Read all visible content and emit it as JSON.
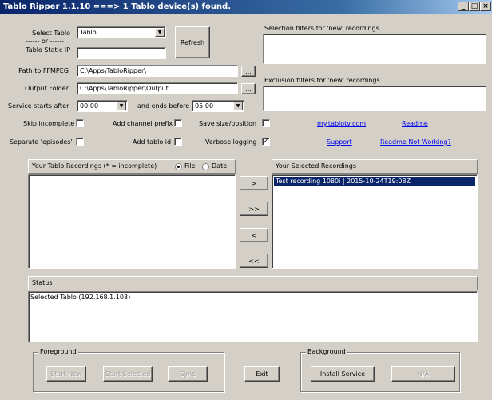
{
  "window": {
    "title": "Tablo Ripper 1.1.10 ===> 1 Tablo device(s) found.",
    "minimize": "_",
    "maximize": "□",
    "close": "×"
  },
  "device": {
    "select_label": "Select Tablo",
    "or_label": "------ or ------",
    "static_ip_label": "Tablo Static IP",
    "selected_tablo": "Tablo",
    "static_ip_value": "",
    "refresh_label": "Refresh"
  },
  "paths": {
    "ffmpeg_label": "Path to FFMPEG",
    "ffmpeg_value": "C:\\Apps\\TabloRipper\\",
    "output_label": "Output Folder",
    "output_value": "C:\\Apps\\TabloRipper\\Output",
    "browse_label": "..."
  },
  "service": {
    "starts_label": "Service starts after",
    "starts_value": "00:00",
    "ends_label": "and ends before",
    "ends_value": "05:00"
  },
  "filters": {
    "selection_label": "Selection filters for 'new' recordings",
    "selection_value": "",
    "exclusion_label": "Exclusion filters for 'new' recordings",
    "exclusion_value": ""
  },
  "options": {
    "skip_incomplete": {
      "label": "Skip incomplete",
      "checked": ""
    },
    "separate_episodes": {
      "label": "Separate 'episodes'",
      "checked": ""
    },
    "add_channel_prefix": {
      "label": "Add channel prefix",
      "checked": ""
    },
    "add_tablo_id": {
      "label": "Add tablo id",
      "checked": ""
    },
    "save_size_position": {
      "label": "Save size/position",
      "checked": ""
    },
    "verbose_logging": {
      "label": "Verbose logging",
      "checked": "✓"
    }
  },
  "links": {
    "mytablo": "my.tablotv.com",
    "readme": "Readme",
    "support": "Support",
    "readme_not_working": "Readme Not Working?"
  },
  "recordings": {
    "your_tablo_header": "Your Tablo Recordings (* = incomplete)",
    "sort_file": "File",
    "sort_date": "Date",
    "selected_header": "Your Selected Recordings",
    "selected_items": [
      "Test recording 1080i | 2015-10-24T19:08Z"
    ],
    "move_right": ">",
    "move_all_right": ">>",
    "move_left": "<",
    "move_all_left": "<<"
  },
  "status": {
    "header": "Status",
    "text": "Selected Tablo (192.168.1.103)"
  },
  "foreground": {
    "title": "Foreground",
    "start_new": "Start New",
    "start_selected": "Start Selected",
    "sync": "Sync"
  },
  "exit_label": "Exit",
  "background": {
    "title": "Background",
    "install_service": "Install Service",
    "na": "N/A"
  }
}
